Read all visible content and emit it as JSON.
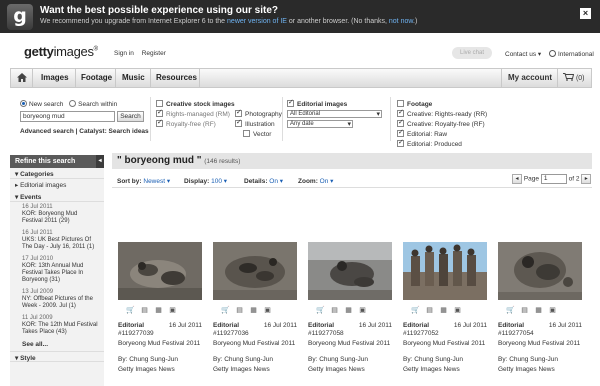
{
  "ie_banner": {
    "logo": "g",
    "title": "Want the best possible experience using our site?",
    "message_start": "We recommend you upgrade from Internet Explorer 6 to the ",
    "link_newer": "newer version of IE",
    "message_mid": " or another browser. (No thanks, ",
    "link_notnow": "not now",
    "message_end": ".)",
    "close": "×"
  },
  "header": {
    "logo_bold": "getty",
    "logo_rest": "images",
    "logo_mark": "®",
    "sign_in": "Sign in",
    "register": "Register",
    "live_chat": "Live chat",
    "contact_us": "Contact us ▾",
    "international": "International"
  },
  "nav": {
    "items": [
      "Images",
      "Footage",
      "Music",
      "Resources"
    ],
    "my_account": "My account",
    "cart_count": "(0)"
  },
  "search": {
    "new_search": "New search",
    "search_within": "Search within",
    "query": "boryeong mud",
    "button": "Search",
    "advanced": "Advanced search",
    "separator": "|",
    "catalyst": "Catalyst: Search ideas",
    "creative": {
      "heading": "Creative stock images",
      "rm": "Rights-managed (RM)",
      "rf": "Royalty-free (RF)",
      "photography": "Photography",
      "illustration": "Illustration",
      "vector": "Vector"
    },
    "editorial": {
      "heading": "Editorial images",
      "select1": "All Editorial",
      "select2": "Any date"
    },
    "footage": {
      "heading": "Footage",
      "items": [
        "Creative: Rights-ready (RR)",
        "Creative: Royalty-free (RF)",
        "Editorial: Raw",
        "Editorial: Produced"
      ]
    }
  },
  "sidebar": {
    "refine": "Refine this search",
    "categories": "Categories",
    "editorial_images": "Editorial images",
    "events_heading": "Events",
    "events": [
      {
        "date": "16 Jul 2011",
        "title": "KOR: Boryeong Mud Festival 2011 (29)"
      },
      {
        "date": "16 Jul 2011",
        "title": "UKS: UK Best Pictures Of The Day - July 16, 2011 (1)"
      },
      {
        "date": "17 Jul 2010",
        "title": "KOR: 13th Annual Mud Festival Takes Place In Boryeong (31)"
      },
      {
        "date": "13 Jul 2009",
        "title": "NY: Offbeat Pictures of the Week - 2009. Jul (1)"
      },
      {
        "date": "11 Jul 2009",
        "title": "KOR: The 12th Mud Festival Takes Place (43)"
      }
    ],
    "see_all": "See all...",
    "style": "Style"
  },
  "results": {
    "title": "\" boryeong mud \"",
    "count": "(146 results)",
    "sort_label": "Sort by:",
    "sort_value": "Newest ▾",
    "display_label": "Display:",
    "display_value": "100 ▾",
    "details_label": "Details:",
    "details_value": "On ▾",
    "zoom_label": "Zoom:",
    "zoom_value": "On ▾",
    "page_label": "Page",
    "page_value": "1",
    "page_of": "of 2"
  },
  "cards": [
    {
      "type": "Editorial",
      "date": "16 Jul 2011",
      "id": "#119277039",
      "title": "Boryeong Mud Festival 2011",
      "by": "By: Chung Sung-Jun",
      "source": "Getty Images News"
    },
    {
      "type": "Editorial",
      "date": "16 Jul 2011",
      "id": "#119277036",
      "title": "Boryeong Mud Festival 2011",
      "by": "By: Chung Sung-Jun",
      "source": "Getty Images News"
    },
    {
      "type": "Editorial",
      "date": "16 Jul 2011",
      "id": "#119277058",
      "title": "Boryeong Mud Festival 2011",
      "by": "By: Chung Sung-Jun",
      "source": "Getty Images News"
    },
    {
      "type": "Editorial",
      "date": "16 Jul 2011",
      "id": "#119277052",
      "title": "Boryeong Mud Festival 2011",
      "by": "By: Chung Sung-Jun",
      "source": "Getty Images News"
    },
    {
      "type": "Editorial",
      "date": "16 Jul 2011",
      "id": "#119277054",
      "title": "Boryeong Mud Festival 2011",
      "by": "By: Chung Sung-Jun",
      "source": "Getty Images News"
    }
  ]
}
